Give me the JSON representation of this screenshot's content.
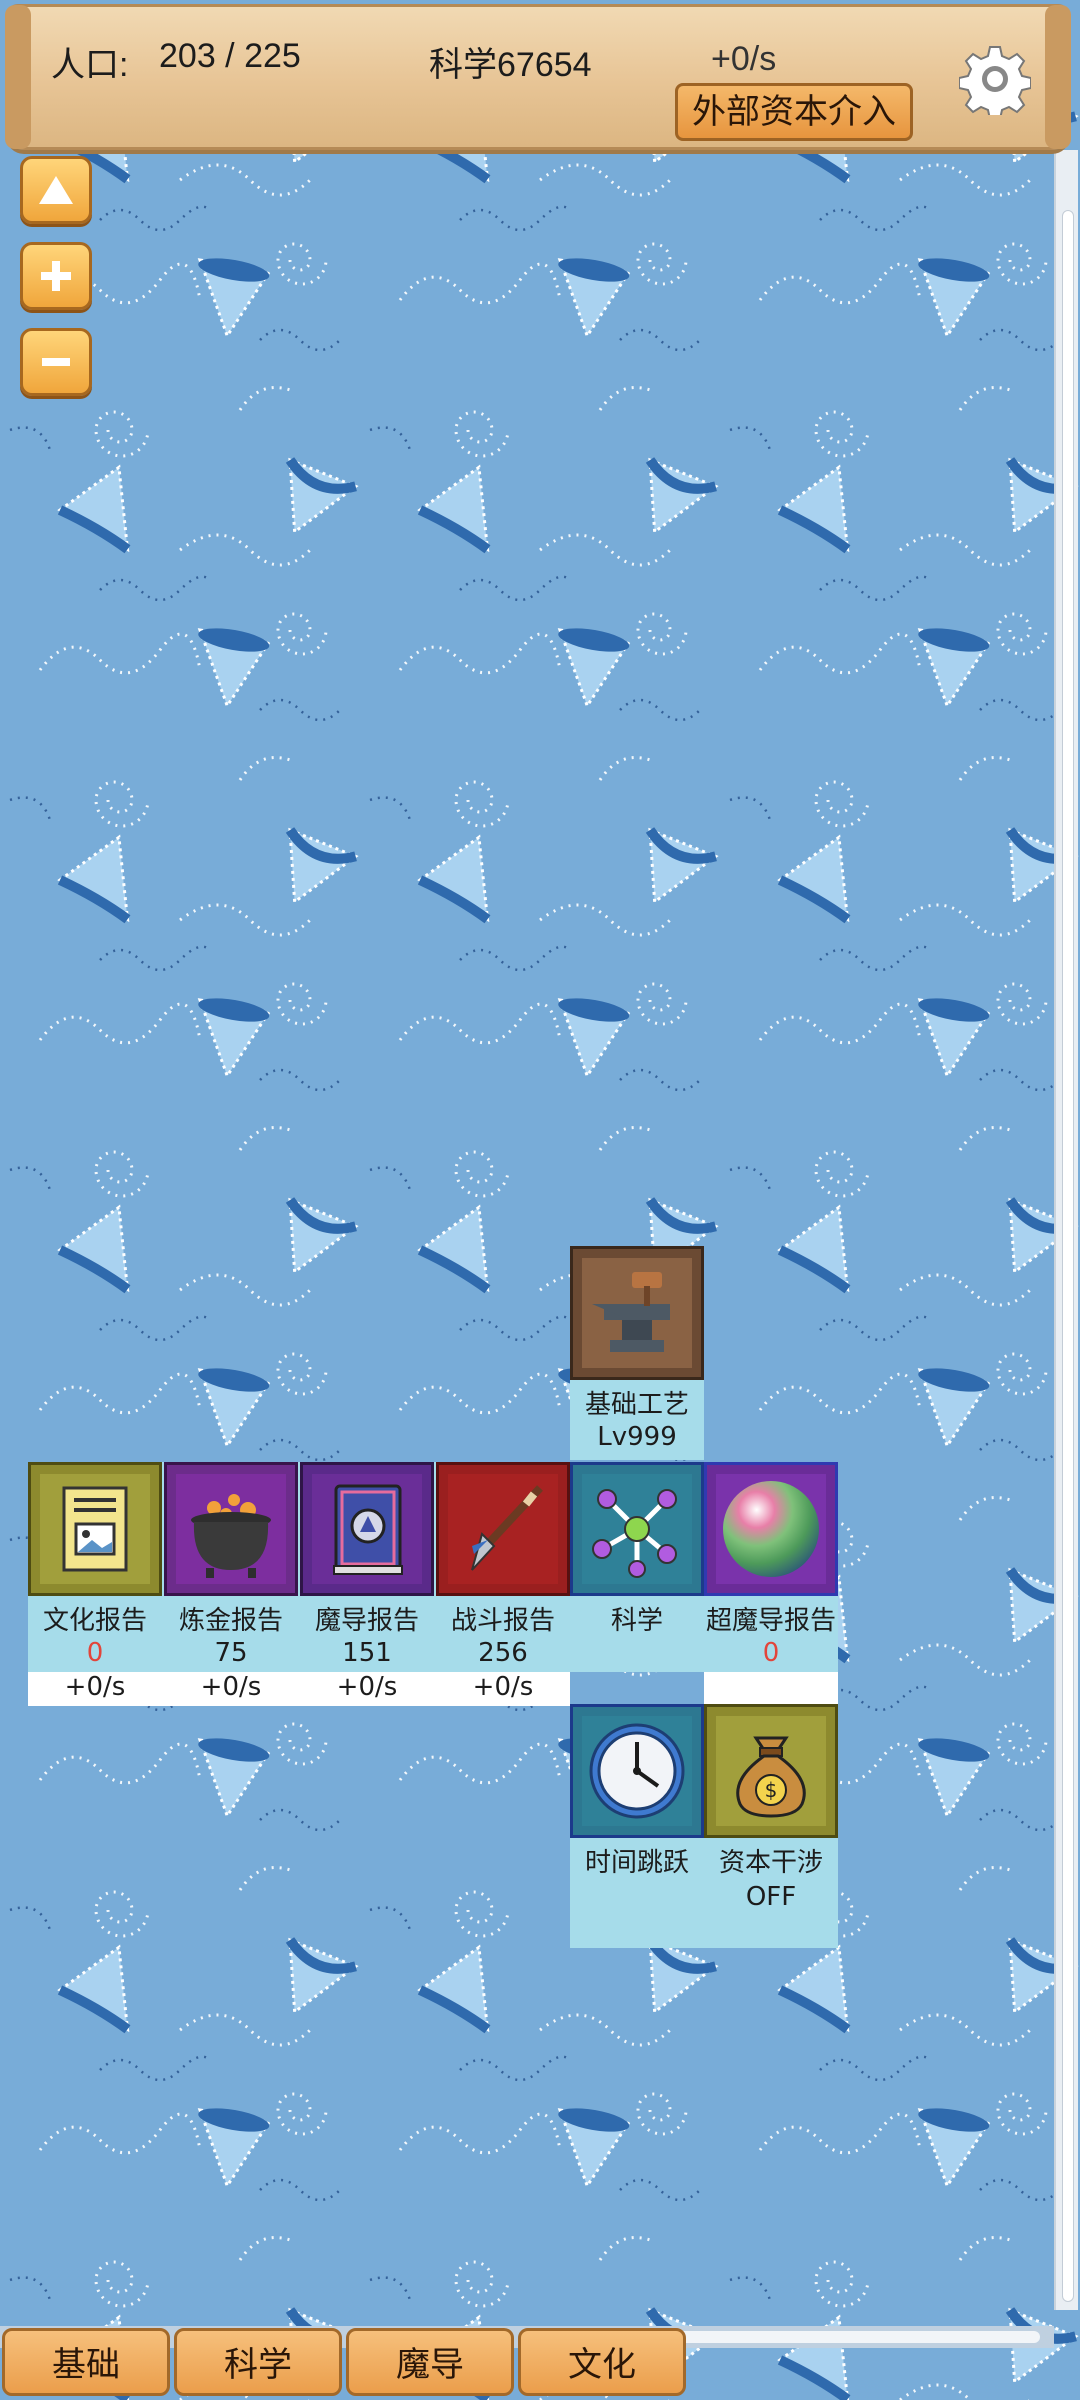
{
  "topbar": {
    "population_label": "人口:",
    "population_value": "203 / 225",
    "science_label": "科学67654",
    "science_rate": "+0/s",
    "external_capital_button": "外部资本介入",
    "settings_icon": "gear-icon"
  },
  "side_controls": {
    "up_icon": "triangle-up-icon",
    "zoom_in_icon": "plus-icon",
    "zoom_out_icon": "minus-icon"
  },
  "tech_tree": {
    "basic_craft": {
      "name": "基础工艺",
      "level": "Lv999",
      "icon": "anvil-icon"
    },
    "culture_report": {
      "name": "文化报告",
      "value": "0",
      "rate": "+0/s",
      "icon": "picture-card-icon"
    },
    "alchemy_report": {
      "name": "炼金报告",
      "value": "75",
      "rate": "+0/s",
      "icon": "cauldron-icon"
    },
    "magic_report": {
      "name": "魔导报告",
      "value": "151",
      "rate": "+0/s",
      "icon": "spellbook-icon"
    },
    "battle_report": {
      "name": "战斗报告",
      "value": "256",
      "rate": "+0/s",
      "icon": "spear-icon"
    },
    "science": {
      "name": "科学",
      "icon": "molecule-icon"
    },
    "super_magic_report": {
      "name": "超魔导报告",
      "value": "0",
      "icon": "orb-icon"
    },
    "time_jump": {
      "name": "时间跳跃",
      "icon": "clock-icon"
    },
    "capital_intervention": {
      "name": "资本干涉",
      "state": "OFF",
      "icon": "money-bag-icon"
    }
  },
  "bottom_tabs": [
    "基础",
    "科学",
    "魔导",
    "文化"
  ]
}
